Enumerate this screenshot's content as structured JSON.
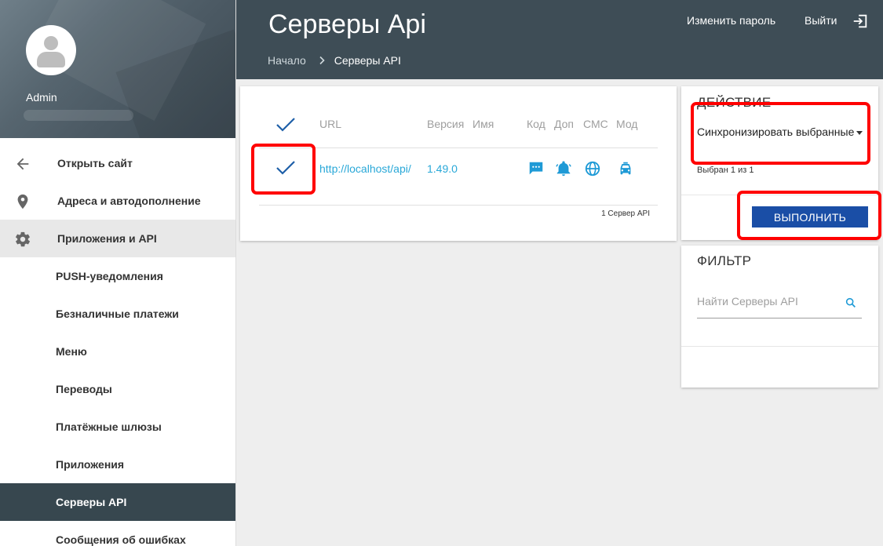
{
  "sidebar": {
    "username": "Admin",
    "items": [
      {
        "label": "Открыть сайт",
        "icon": "arrow-left-icon"
      },
      {
        "label": "Адреса и автодополнение",
        "icon": "map-pin-icon"
      },
      {
        "label": "Приложения и API",
        "icon": "gear-icon"
      },
      {
        "label": "PUSH-уведомления"
      },
      {
        "label": "Безналичные платежи"
      },
      {
        "label": "Меню"
      },
      {
        "label": "Переводы"
      },
      {
        "label": "Платёжные шлюзы"
      },
      {
        "label": "Приложения"
      },
      {
        "label": "Серверы API"
      },
      {
        "label": "Сообщения об ошибках"
      }
    ]
  },
  "header": {
    "title": "Серверы Api",
    "breadcrumb": [
      "Начало",
      "Серверы API"
    ],
    "change_password": "Изменить пароль",
    "logout": "Выйти"
  },
  "table": {
    "columns": [
      "URL",
      "Версия",
      "Имя",
      "Код",
      "Доп",
      "СМС",
      "Мод"
    ],
    "rows": [
      {
        "url": "http://localhost/api/",
        "version": "1.49.0",
        "name": "",
        "checked": true,
        "icons": [
          "sms-icon",
          "bell-icon",
          "globe-icon",
          "taxi-icon"
        ]
      }
    ],
    "footer": "1 Сервер API"
  },
  "action": {
    "title": "ДЕЙСТВИЕ",
    "selected_option": "Синхронизировать выбранные",
    "selection_info": "Выбран 1 из 1",
    "execute_label": "ВЫПОЛНИТЬ"
  },
  "filter": {
    "title": "ФИЛЬТР",
    "placeholder": "Найти Серверы API"
  },
  "colors": {
    "header_bg": "#3e4d56",
    "active_nav_bg": "#37474f",
    "link": "#29a8d8",
    "accent_icon": "#1e9ad6",
    "execute_button": "#1a4ea6",
    "highlight_box": "#ff0000"
  }
}
